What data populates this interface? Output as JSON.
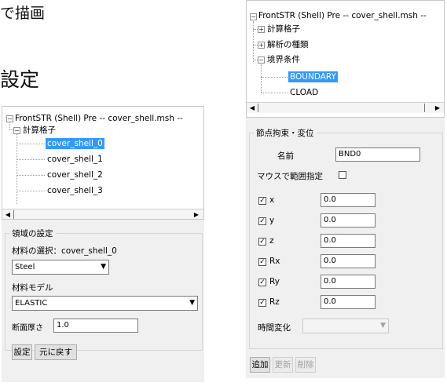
{
  "slide": {
    "top_text": "で描画",
    "mid_text": "設定"
  },
  "left": {
    "tree": {
      "root": "FrontSTR (Shell) Pre -- cover_shell.msh --",
      "group": "計算格子",
      "children": [
        "cover_shell_0",
        "cover_shell_1",
        "cover_shell_2",
        "cover_shell_3"
      ],
      "selected_index": 0
    },
    "domain": {
      "legend": "領域の設定",
      "material_select_label": "材料の選択：cover_shell_0",
      "material_value": "Steel",
      "model_label": "材料モデル",
      "model_value": "ELASTIC",
      "thickness_label": "断面厚さ",
      "thickness_value": "1.0",
      "set_button": "設定",
      "revert_button": "元に戻す"
    }
  },
  "right": {
    "tree": {
      "root": "FrontSTR (Shell) Pre -- cover_shell.msh --",
      "items": [
        "計算格子",
        "解析の種類",
        "境界条件"
      ],
      "children": [
        "BOUNDARY",
        "CLOAD"
      ],
      "selected": "BOUNDARY"
    },
    "constraint": {
      "legend": "節点拘束・変位",
      "name_label": "名前",
      "name_value": "BND0",
      "mouse_range_label": "マウスで範囲指定",
      "dofs": [
        {
          "label": "x",
          "value": "0.0",
          "checked": true
        },
        {
          "label": "y",
          "value": "0.0",
          "checked": true
        },
        {
          "label": "z",
          "value": "0.0",
          "checked": true
        },
        {
          "label": "Rx",
          "value": "0.0",
          "checked": true
        },
        {
          "label": "Ry",
          "value": "0.0",
          "checked": true
        },
        {
          "label": "Rz",
          "value": "0.0",
          "checked": true
        }
      ],
      "time_label": "時間変化",
      "time_value": "",
      "add_button": "追加",
      "update_button": "更新",
      "delete_button": "削除"
    }
  },
  "colors": {
    "selection": "#3399ff",
    "panel_bg": "#f0f0f0"
  }
}
